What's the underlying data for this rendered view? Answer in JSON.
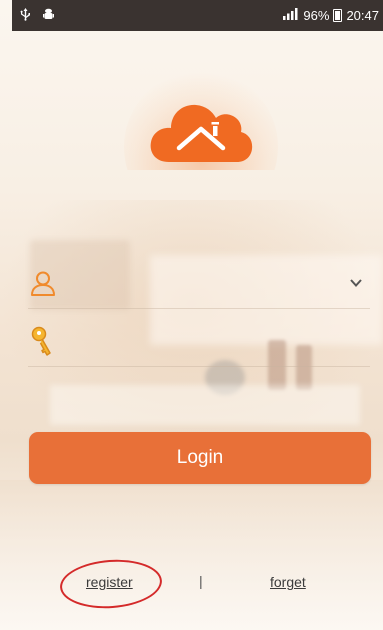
{
  "status_bar": {
    "signal_icon": "signal-bars-icon",
    "battery_percent": "96%",
    "time": "20:47"
  },
  "colors": {
    "accent": "#e87038",
    "icon_orange": "#f08a2c",
    "status_bar_bg": "#3a3330",
    "annotation_red": "#d42a2a"
  },
  "login_form": {
    "username_icon": "user-outline-icon",
    "username_value": "",
    "password_icon": "key-icon",
    "password_value": "",
    "dropdown_icon": "chevron-down-icon",
    "login_label": "Login"
  },
  "footer": {
    "register_label": "register",
    "divider": "|",
    "forget_label": "forget"
  }
}
